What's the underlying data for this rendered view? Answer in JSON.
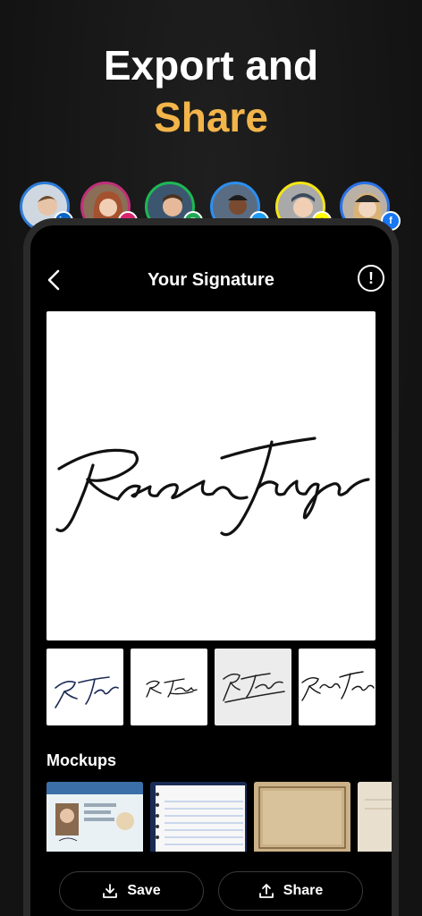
{
  "headline": {
    "line1": "Export and",
    "line2": "Share"
  },
  "social_avatars": [
    {
      "name": "linkedin",
      "ring": "#2d7bd8",
      "badge_color": "#0a66c2",
      "badge_icon": "in"
    },
    {
      "name": "instagram",
      "ring": "#c0307a",
      "badge_color": "#d6246d",
      "badge_icon": "ig"
    },
    {
      "name": "whatsapp",
      "ring": "#1eb854",
      "badge_color": "#1fa855",
      "badge_icon": "wa"
    },
    {
      "name": "twitter",
      "ring": "#2c8ff0",
      "badge_color": "#1d9bf0",
      "badge_icon": "tw"
    },
    {
      "name": "snapchat",
      "ring": "#f4e514",
      "badge_color": "#fffc00",
      "badge_icon": "sc"
    },
    {
      "name": "facebook",
      "ring": "#2a72e8",
      "badge_color": "#1877f2",
      "badge_icon": "f"
    }
  ],
  "app": {
    "title": "Your Signature",
    "back_icon": "chevron-left-icon",
    "info_icon": "info-icon",
    "info_glyph": "!"
  },
  "signature": {
    "text": "Rachel Taylor"
  },
  "variants": [
    {
      "text": "R. Taylor",
      "selected": false
    },
    {
      "text": "R. Taylor",
      "selected": false
    },
    {
      "text": "R. Taylor",
      "selected": true
    },
    {
      "text": "Rachel Taylor",
      "selected": false
    }
  ],
  "mockups": {
    "label": "Mockups",
    "items": [
      "id-card",
      "notebook",
      "parchment",
      "paper"
    ]
  },
  "actions": {
    "save_label": "Save",
    "share_label": "Share"
  },
  "colors": {
    "accent": "#f3b54a",
    "background": "#151515"
  }
}
